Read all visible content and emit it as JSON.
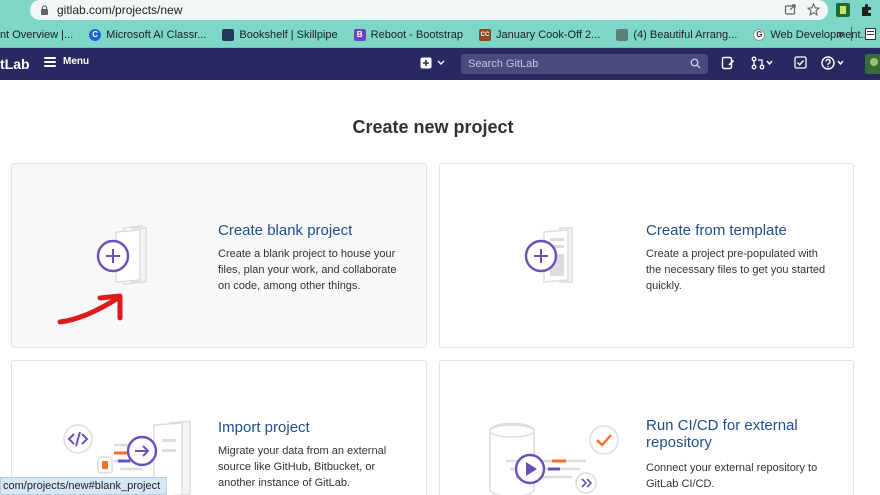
{
  "browser": {
    "url": "gitlab.com/projects/new",
    "bookmarks": [
      {
        "label": "nt Overview |...",
        "color": "#f29c1f",
        "glyph": ""
      },
      {
        "label": "Microsoft AI Classr...",
        "color": "#1b64d8",
        "glyph": "C"
      },
      {
        "label": "Bookshelf | Skillpipe",
        "color": "#23395b",
        "glyph": ""
      },
      {
        "label": "Reboot - Bootstrap",
        "color": "#6f42c1",
        "glyph": "B"
      },
      {
        "label": "January Cook-Off 2...",
        "color": "#8b4b1f",
        "glyph": "CC"
      },
      {
        "label": "(4) Beautiful Arrang...",
        "color": "#5c7f7a",
        "glyph": ""
      },
      {
        "label": "Web Development...",
        "color": "#ffffff",
        "glyph": "G"
      }
    ],
    "bookmarks_more": "»",
    "status_text": "com/projects/new#blank_project"
  },
  "header": {
    "logo_text": "tLab",
    "menu_label": "Menu",
    "search_placeholder": "Search GitLab"
  },
  "page": {
    "title": "Create new project"
  },
  "cards": [
    {
      "title": "Create blank project",
      "desc": "Create a blank project to house your files, plan your work, and collaborate on code, among other things."
    },
    {
      "title": "Create from template",
      "desc": "Create a project pre-populated with the necessary files to get you started quickly."
    },
    {
      "title": "Import project",
      "desc": "Migrate your data from an external source like GitHub, Bitbucket, or another instance of GitLab."
    },
    {
      "title": "Run CI/CD for external repository",
      "desc": "Connect your external repository to GitLab CI/CD."
    }
  ],
  "colors": {
    "accent_purple": "#6b4fbb",
    "header_bg": "#292961",
    "title_blue": "#1f4e8c",
    "arrow_red": "#e0191f",
    "chrome_teal": "#7ed6c9"
  }
}
